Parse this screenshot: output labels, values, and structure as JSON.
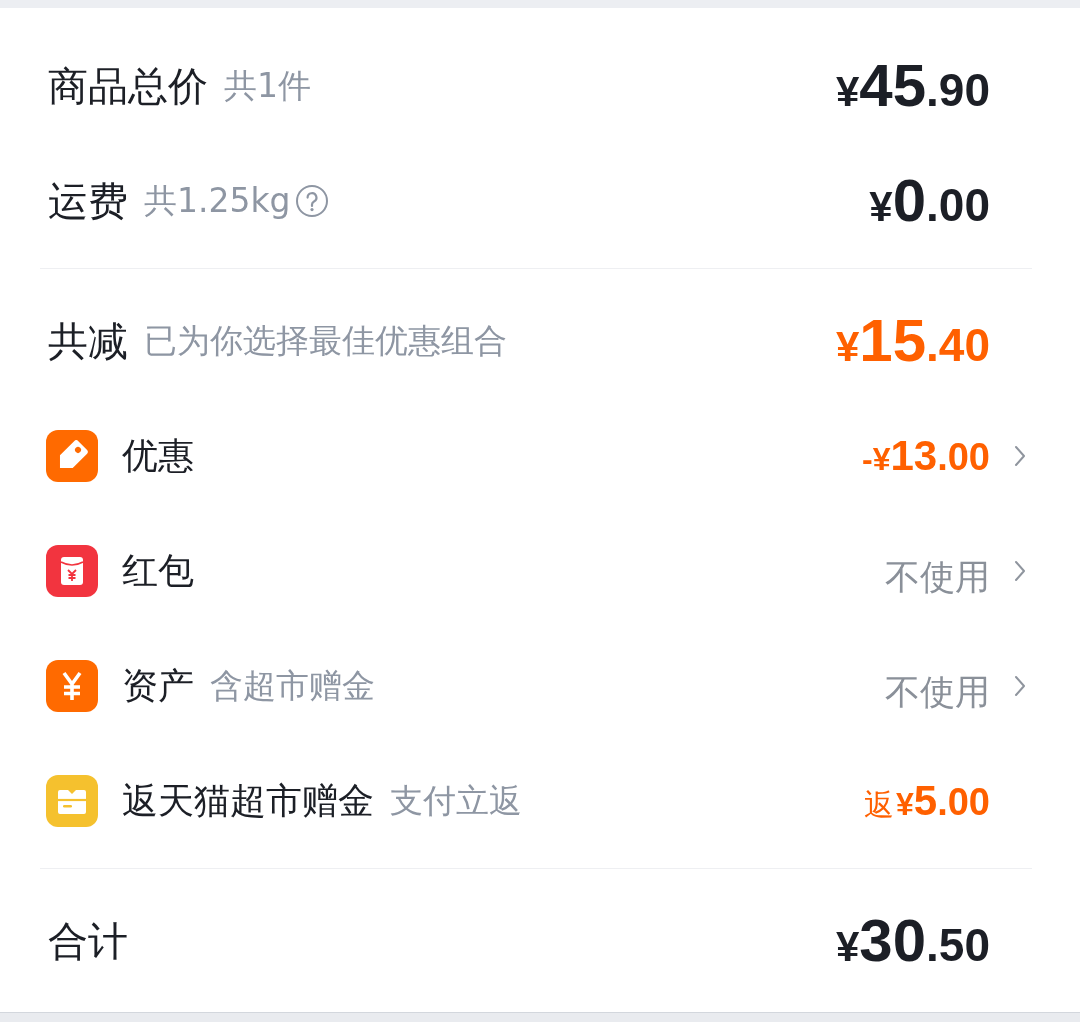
{
  "summary": [
    {
      "label": "商品总价",
      "note": "共1件",
      "help": false,
      "amount": "¥45.90"
    },
    {
      "label": "运费",
      "note": "共1.25kg",
      "help": true,
      "amount": "¥0.00"
    }
  ],
  "savings": {
    "label": "共减",
    "note": "已为你选择最佳优惠组合",
    "amount": "¥15.40"
  },
  "options": [
    {
      "kind": "coupon",
      "label": "优惠",
      "value": "-¥13.00",
      "applied": true,
      "chevron": true
    },
    {
      "kind": "red_packet",
      "label": "红包",
      "value": "不使用",
      "applied": false,
      "chevron": true
    },
    {
      "kind": "assets",
      "label": "资产",
      "note": "含超市赠金",
      "value": "不使用",
      "applied": false,
      "chevron": true
    },
    {
      "kind": "rebate",
      "label": "返天猫超市赠金",
      "note": "支付立返",
      "prefix": "返",
      "value": "¥5.00",
      "applied": true,
      "chevron": false
    }
  ],
  "total": {
    "label": "合计",
    "amount": "¥30.50"
  }
}
